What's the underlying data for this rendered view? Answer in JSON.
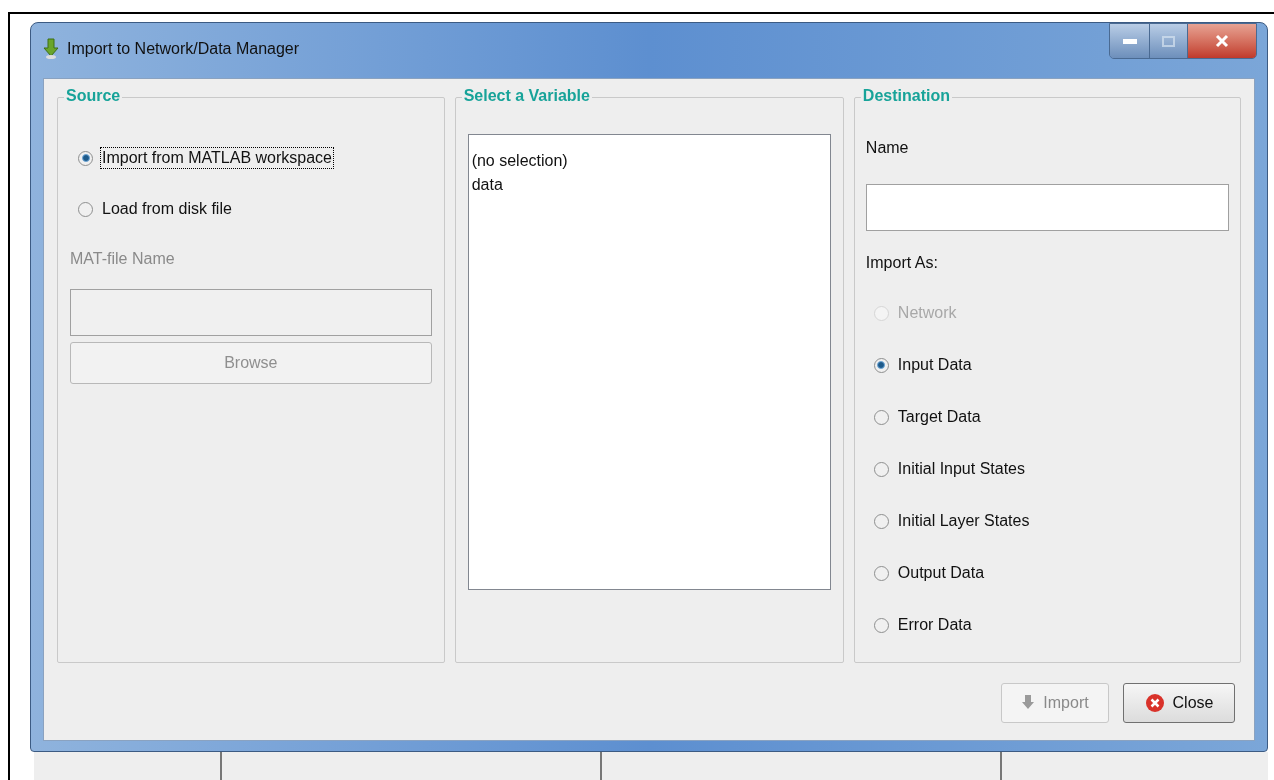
{
  "window": {
    "title": "Import to Network/Data Manager"
  },
  "source": {
    "title": "Source",
    "options": [
      {
        "label": "Import from MATLAB workspace",
        "selected": true,
        "focused": true,
        "disabled": false
      },
      {
        "label": "Load from disk file",
        "selected": false,
        "focused": false,
        "disabled": false
      }
    ],
    "file_label": "MAT-file Name",
    "file_field": {
      "disabled": true
    },
    "browse_button": {
      "label": "Browse",
      "disabled": true
    }
  },
  "variable": {
    "title": "Select a Variable",
    "items": [
      {
        "label": "(no selection)",
        "selected": false
      },
      {
        "label": "data",
        "selected": false
      }
    ]
  },
  "destination": {
    "title": "Destination",
    "name_label": "Name",
    "import_as_label": "Import As:",
    "options": [
      {
        "label": "Network",
        "selected": false,
        "disabled": true
      },
      {
        "label": "Input Data",
        "selected": true,
        "disabled": false
      },
      {
        "label": "Target Data",
        "selected": false,
        "disabled": false
      },
      {
        "label": "Initial Input States",
        "selected": false,
        "disabled": false
      },
      {
        "label": "Initial Layer States",
        "selected": false,
        "disabled": false
      },
      {
        "label": "Output Data",
        "selected": false,
        "disabled": false
      },
      {
        "label": "Error Data",
        "selected": false,
        "disabled": false
      }
    ]
  },
  "buttons": [
    {
      "kind": "import",
      "label": "Import",
      "disabled": true
    },
    {
      "kind": "close",
      "label": "Close",
      "disabled": false
    }
  ]
}
